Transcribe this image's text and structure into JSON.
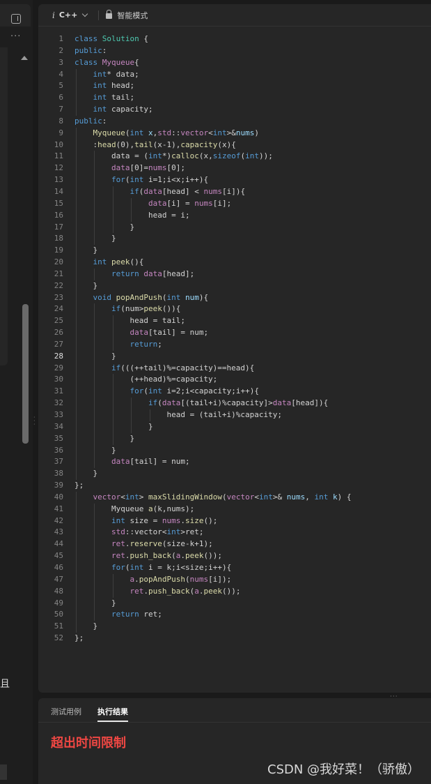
{
  "toolbar": {
    "language_icon": "i",
    "language": "C++",
    "mode_label": "智能模式"
  },
  "left_panel": {
    "more_label": "···",
    "partial_text": "且"
  },
  "editor": {
    "current_line": 28,
    "lines": [
      [
        [
          "k",
          "class "
        ],
        [
          "t",
          "Solution "
        ],
        [
          "",
          "{"
        ]
      ],
      [
        [
          "k",
          "public"
        ],
        [
          "",
          ":"
        ]
      ],
      [
        [
          "k",
          "class "
        ],
        [
          "v",
          "Myqueue"
        ],
        [
          "",
          "{"
        ]
      ],
      [
        [
          "",
          "    "
        ],
        [
          "k",
          "int"
        ],
        [
          "",
          "* data;"
        ]
      ],
      [
        [
          "",
          "    "
        ],
        [
          "k",
          "int"
        ],
        [
          "",
          " head;"
        ]
      ],
      [
        [
          "",
          "    "
        ],
        [
          "k",
          "int"
        ],
        [
          "",
          " tail;"
        ]
      ],
      [
        [
          "",
          "    "
        ],
        [
          "k",
          "int"
        ],
        [
          "",
          " capacity;"
        ]
      ],
      [
        [
          "k",
          "public"
        ],
        [
          "",
          ":"
        ]
      ],
      [
        [
          "",
          "    "
        ],
        [
          "f",
          "Myqueue"
        ],
        [
          "",
          "("
        ],
        [
          "k",
          "int "
        ],
        [
          "p",
          "x"
        ],
        [
          "",
          ","
        ],
        [
          "v",
          "std"
        ],
        [
          "",
          "::"
        ],
        [
          "v",
          "vector"
        ],
        [
          "",
          "<"
        ],
        [
          "k",
          "int"
        ],
        [
          "",
          "&gt;&amp;"
        ],
        [
          "p",
          "nums"
        ],
        [
          "",
          ")"
        ]
      ],
      [
        [
          "",
          "    :"
        ],
        [
          "f",
          "head"
        ],
        [
          "",
          "(0),"
        ],
        [
          "f",
          "tail"
        ],
        [
          "",
          "(x-1),"
        ],
        [
          "f",
          "capacity"
        ],
        [
          "",
          "(x){"
        ]
      ],
      [
        [
          "",
          "        data = ("
        ],
        [
          "k",
          "int"
        ],
        [
          "",
          "*)"
        ],
        [
          "f",
          "calloc"
        ],
        [
          "",
          "(x,"
        ],
        [
          "k",
          "sizeof"
        ],
        [
          "",
          "("
        ],
        [
          "k",
          "int"
        ],
        [
          "",
          "));"
        ]
      ],
      [
        [
          "",
          "        "
        ],
        [
          "v",
          "data"
        ],
        [
          "",
          "[0]="
        ],
        [
          "v",
          "nums"
        ],
        [
          "",
          "[0];"
        ]
      ],
      [
        [
          "",
          "        "
        ],
        [
          "k",
          "for"
        ],
        [
          "",
          "("
        ],
        [
          "k",
          "int "
        ],
        [
          "",
          "i=1;i&lt;x;i++){"
        ]
      ],
      [
        [
          "",
          "            "
        ],
        [
          "k",
          "if"
        ],
        [
          "",
          "("
        ],
        [
          "v",
          "data"
        ],
        [
          "",
          "[head] &lt; "
        ],
        [
          "v",
          "nums"
        ],
        [
          "",
          "[i]){"
        ]
      ],
      [
        [
          "",
          "                "
        ],
        [
          "v",
          "data"
        ],
        [
          "",
          "[i] = "
        ],
        [
          "v",
          "nums"
        ],
        [
          "",
          "[i];"
        ]
      ],
      [
        [
          "",
          "                head = i;"
        ]
      ],
      [
        [
          "",
          "            }"
        ]
      ],
      [
        [
          "",
          "        }"
        ]
      ],
      [
        [
          "",
          "    }"
        ]
      ],
      [
        [
          "",
          "    "
        ],
        [
          "k",
          "int "
        ],
        [
          "f",
          "peek"
        ],
        [
          "",
          "(){"
        ]
      ],
      [
        [
          "",
          "        "
        ],
        [
          "k",
          "return "
        ],
        [
          "v",
          "data"
        ],
        [
          "",
          "[head];"
        ]
      ],
      [
        [
          "",
          "    }"
        ]
      ],
      [
        [
          "",
          "    "
        ],
        [
          "k",
          "void "
        ],
        [
          "f",
          "popAndPush"
        ],
        [
          "",
          "("
        ],
        [
          "k",
          "int "
        ],
        [
          "p",
          "num"
        ],
        [
          "",
          "){"
        ]
      ],
      [
        [
          "",
          "        "
        ],
        [
          "k",
          "if"
        ],
        [
          "",
          "(num&gt;"
        ],
        [
          "f",
          "peek"
        ],
        [
          "",
          "()){"
        ]
      ],
      [
        [
          "",
          "            head = tail;"
        ]
      ],
      [
        [
          "",
          "            "
        ],
        [
          "v",
          "data"
        ],
        [
          "",
          "[tail] = num;"
        ]
      ],
      [
        [
          "",
          "            "
        ],
        [
          "k",
          "return"
        ],
        [
          "",
          ";"
        ]
      ],
      [
        [
          "",
          "        }"
        ]
      ],
      [
        [
          "",
          "        "
        ],
        [
          "k",
          "if"
        ],
        [
          "",
          "(((++tail)%=capacity)==head){"
        ]
      ],
      [
        [
          "",
          "            (++head)%=capacity;"
        ]
      ],
      [
        [
          "",
          "            "
        ],
        [
          "k",
          "for"
        ],
        [
          "",
          "("
        ],
        [
          "k",
          "int "
        ],
        [
          "",
          "i=2;i&lt;capacity;i++){"
        ]
      ],
      [
        [
          "",
          "                "
        ],
        [
          "k",
          "if"
        ],
        [
          "",
          "("
        ],
        [
          "v",
          "data"
        ],
        [
          "",
          "[(tail+i)%capacity]&gt;"
        ],
        [
          "v",
          "data"
        ],
        [
          "",
          "[head]){"
        ]
      ],
      [
        [
          "",
          "                    head = (tail+i)%capacity;"
        ]
      ],
      [
        [
          "",
          "                }"
        ]
      ],
      [
        [
          "",
          "            }"
        ]
      ],
      [
        [
          "",
          "        }"
        ]
      ],
      [
        [
          "",
          "        "
        ],
        [
          "v",
          "data"
        ],
        [
          "",
          "[tail] = num;"
        ]
      ],
      [
        [
          "",
          "    }"
        ]
      ],
      [
        [
          "",
          "};"
        ]
      ],
      [
        [
          "",
          "    "
        ],
        [
          "v",
          "vector"
        ],
        [
          "",
          "&lt;"
        ],
        [
          "k",
          "int"
        ],
        [
          "",
          "&gt; "
        ],
        [
          "f",
          "maxSlidingWindow"
        ],
        [
          "",
          "("
        ],
        [
          "v",
          "vector"
        ],
        [
          "",
          "&lt;"
        ],
        [
          "k",
          "int"
        ],
        [
          "",
          "&gt;&amp; "
        ],
        [
          "p",
          "nums"
        ],
        [
          "",
          ", "
        ],
        [
          "k",
          "int "
        ],
        [
          "p",
          "k"
        ],
        [
          "",
          ") {"
        ]
      ],
      [
        [
          "",
          "        Myqueue "
        ],
        [
          "f",
          "a"
        ],
        [
          "",
          "(k,nums);"
        ]
      ],
      [
        [
          "",
          "        "
        ],
        [
          "k",
          "int "
        ],
        [
          "",
          "size = "
        ],
        [
          "v",
          "nums"
        ],
        [
          "",
          "."
        ],
        [
          "f",
          "size"
        ],
        [
          "",
          "();"
        ]
      ],
      [
        [
          "",
          "        "
        ],
        [
          "v",
          "std"
        ],
        [
          "",
          "::vector&lt;"
        ],
        [
          "k",
          "int"
        ],
        [
          "",
          "&gt;ret;"
        ]
      ],
      [
        [
          "",
          "        "
        ],
        [
          "v",
          "ret"
        ],
        [
          "",
          "."
        ],
        [
          "f",
          "reserve"
        ],
        [
          "",
          "(size-k+1);"
        ]
      ],
      [
        [
          "",
          "        "
        ],
        [
          "v",
          "ret"
        ],
        [
          "",
          "."
        ],
        [
          "f",
          "push_back"
        ],
        [
          "",
          "("
        ],
        [
          "v",
          "a"
        ],
        [
          "",
          "."
        ],
        [
          "f",
          "peek"
        ],
        [
          "",
          "());"
        ]
      ],
      [
        [
          "",
          "        "
        ],
        [
          "k",
          "for"
        ],
        [
          "",
          "("
        ],
        [
          "k",
          "int "
        ],
        [
          "",
          "i = k;i&lt;size;i++){"
        ]
      ],
      [
        [
          "",
          "            "
        ],
        [
          "v",
          "a"
        ],
        [
          "",
          "."
        ],
        [
          "f",
          "popAndPush"
        ],
        [
          "",
          "("
        ],
        [
          "v",
          "nums"
        ],
        [
          "",
          "[i]);"
        ]
      ],
      [
        [
          "",
          "            "
        ],
        [
          "v",
          "ret"
        ],
        [
          "",
          "."
        ],
        [
          "f",
          "push_back"
        ],
        [
          "",
          "("
        ],
        [
          "v",
          "a"
        ],
        [
          "",
          "."
        ],
        [
          "f",
          "peek"
        ],
        [
          "",
          "());"
        ]
      ],
      [
        [
          "",
          "        }"
        ]
      ],
      [
        [
          "",
          "        "
        ],
        [
          "k",
          "return "
        ],
        [
          "",
          "ret;"
        ]
      ],
      [
        [
          "",
          "    }"
        ]
      ],
      [
        [
          "",
          "};"
        ]
      ]
    ]
  },
  "bottom": {
    "tabs": [
      "测试用例",
      "执行结果"
    ],
    "active_tab": 1,
    "result_text": "超出时间限制",
    "watermark": "CSDN @我好菜！（骄傲）"
  }
}
